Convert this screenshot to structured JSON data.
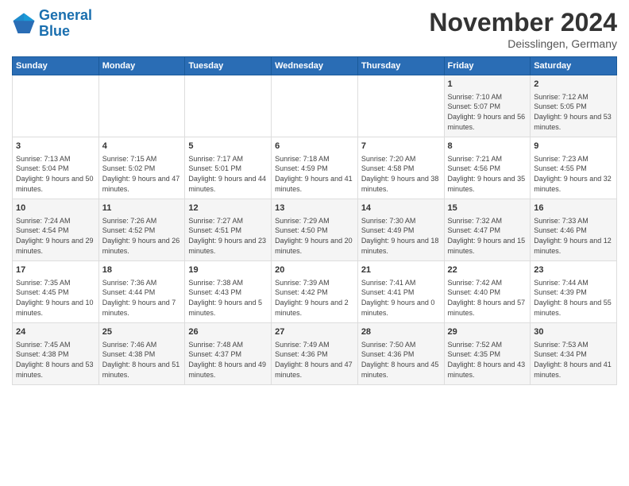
{
  "header": {
    "logo_line1": "General",
    "logo_line2": "Blue",
    "title": "November 2024",
    "location": "Deisslingen, Germany"
  },
  "days_of_week": [
    "Sunday",
    "Monday",
    "Tuesday",
    "Wednesday",
    "Thursday",
    "Friday",
    "Saturday"
  ],
  "weeks": [
    [
      {
        "day": "",
        "info": ""
      },
      {
        "day": "",
        "info": ""
      },
      {
        "day": "",
        "info": ""
      },
      {
        "day": "",
        "info": ""
      },
      {
        "day": "",
        "info": ""
      },
      {
        "day": "1",
        "info": "Sunrise: 7:10 AM\nSunset: 5:07 PM\nDaylight: 9 hours and 56 minutes."
      },
      {
        "day": "2",
        "info": "Sunrise: 7:12 AM\nSunset: 5:05 PM\nDaylight: 9 hours and 53 minutes."
      }
    ],
    [
      {
        "day": "3",
        "info": "Sunrise: 7:13 AM\nSunset: 5:04 PM\nDaylight: 9 hours and 50 minutes."
      },
      {
        "day": "4",
        "info": "Sunrise: 7:15 AM\nSunset: 5:02 PM\nDaylight: 9 hours and 47 minutes."
      },
      {
        "day": "5",
        "info": "Sunrise: 7:17 AM\nSunset: 5:01 PM\nDaylight: 9 hours and 44 minutes."
      },
      {
        "day": "6",
        "info": "Sunrise: 7:18 AM\nSunset: 4:59 PM\nDaylight: 9 hours and 41 minutes."
      },
      {
        "day": "7",
        "info": "Sunrise: 7:20 AM\nSunset: 4:58 PM\nDaylight: 9 hours and 38 minutes."
      },
      {
        "day": "8",
        "info": "Sunrise: 7:21 AM\nSunset: 4:56 PM\nDaylight: 9 hours and 35 minutes."
      },
      {
        "day": "9",
        "info": "Sunrise: 7:23 AM\nSunset: 4:55 PM\nDaylight: 9 hours and 32 minutes."
      }
    ],
    [
      {
        "day": "10",
        "info": "Sunrise: 7:24 AM\nSunset: 4:54 PM\nDaylight: 9 hours and 29 minutes."
      },
      {
        "day": "11",
        "info": "Sunrise: 7:26 AM\nSunset: 4:52 PM\nDaylight: 9 hours and 26 minutes."
      },
      {
        "day": "12",
        "info": "Sunrise: 7:27 AM\nSunset: 4:51 PM\nDaylight: 9 hours and 23 minutes."
      },
      {
        "day": "13",
        "info": "Sunrise: 7:29 AM\nSunset: 4:50 PM\nDaylight: 9 hours and 20 minutes."
      },
      {
        "day": "14",
        "info": "Sunrise: 7:30 AM\nSunset: 4:49 PM\nDaylight: 9 hours and 18 minutes."
      },
      {
        "day": "15",
        "info": "Sunrise: 7:32 AM\nSunset: 4:47 PM\nDaylight: 9 hours and 15 minutes."
      },
      {
        "day": "16",
        "info": "Sunrise: 7:33 AM\nSunset: 4:46 PM\nDaylight: 9 hours and 12 minutes."
      }
    ],
    [
      {
        "day": "17",
        "info": "Sunrise: 7:35 AM\nSunset: 4:45 PM\nDaylight: 9 hours and 10 minutes."
      },
      {
        "day": "18",
        "info": "Sunrise: 7:36 AM\nSunset: 4:44 PM\nDaylight: 9 hours and 7 minutes."
      },
      {
        "day": "19",
        "info": "Sunrise: 7:38 AM\nSunset: 4:43 PM\nDaylight: 9 hours and 5 minutes."
      },
      {
        "day": "20",
        "info": "Sunrise: 7:39 AM\nSunset: 4:42 PM\nDaylight: 9 hours and 2 minutes."
      },
      {
        "day": "21",
        "info": "Sunrise: 7:41 AM\nSunset: 4:41 PM\nDaylight: 9 hours and 0 minutes."
      },
      {
        "day": "22",
        "info": "Sunrise: 7:42 AM\nSunset: 4:40 PM\nDaylight: 8 hours and 57 minutes."
      },
      {
        "day": "23",
        "info": "Sunrise: 7:44 AM\nSunset: 4:39 PM\nDaylight: 8 hours and 55 minutes."
      }
    ],
    [
      {
        "day": "24",
        "info": "Sunrise: 7:45 AM\nSunset: 4:38 PM\nDaylight: 8 hours and 53 minutes."
      },
      {
        "day": "25",
        "info": "Sunrise: 7:46 AM\nSunset: 4:38 PM\nDaylight: 8 hours and 51 minutes."
      },
      {
        "day": "26",
        "info": "Sunrise: 7:48 AM\nSunset: 4:37 PM\nDaylight: 8 hours and 49 minutes."
      },
      {
        "day": "27",
        "info": "Sunrise: 7:49 AM\nSunset: 4:36 PM\nDaylight: 8 hours and 47 minutes."
      },
      {
        "day": "28",
        "info": "Sunrise: 7:50 AM\nSunset: 4:36 PM\nDaylight: 8 hours and 45 minutes."
      },
      {
        "day": "29",
        "info": "Sunrise: 7:52 AM\nSunset: 4:35 PM\nDaylight: 8 hours and 43 minutes."
      },
      {
        "day": "30",
        "info": "Sunrise: 7:53 AM\nSunset: 4:34 PM\nDaylight: 8 hours and 41 minutes."
      }
    ]
  ]
}
